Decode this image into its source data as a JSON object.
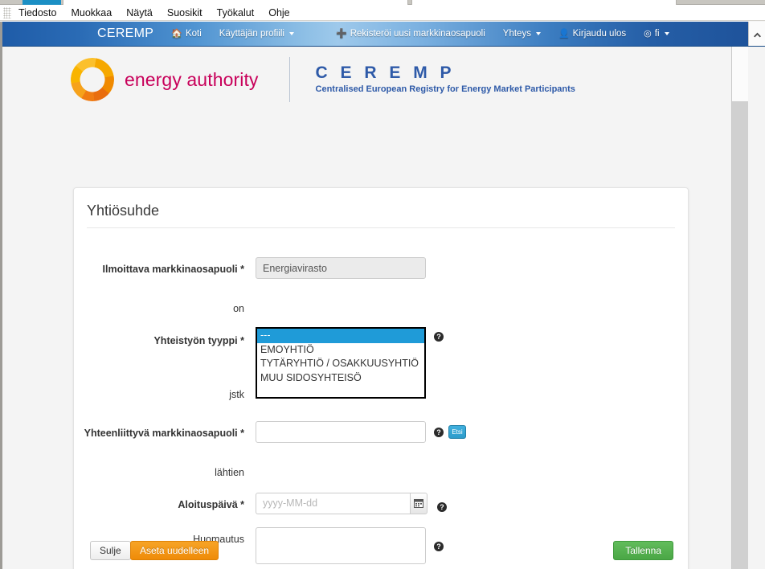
{
  "browser": {
    "menu_items": [
      "Tiedosto",
      "Muokkaa",
      "Näytä",
      "Suosikit",
      "Työkalut",
      "Ohje"
    ]
  },
  "topnav": {
    "brand": "CEREMP",
    "links": [
      {
        "label": "Koti",
        "icon": "home-icon",
        "glyph": "⌂",
        "caret": false
      },
      {
        "label": "Käyttäjän profiili",
        "icon": "",
        "glyph": "",
        "caret": true
      },
      {
        "label": "Rekisteröi uusi markkinaosapuoli",
        "icon": "plus-icon",
        "glyph": "✚",
        "caret": false
      },
      {
        "label": "Yhteys",
        "icon": "",
        "glyph": "",
        "caret": true
      },
      {
        "label": "Kirjaudu ulos",
        "icon": "user-icon",
        "glyph": "👤",
        "caret": false
      },
      {
        "label": "fi",
        "icon": "globe-icon",
        "glyph": "◉",
        "caret": true
      }
    ],
    "scroll_up_glyph": "▲"
  },
  "header": {
    "energy_authority": "energy authority",
    "ceremp_title": "C E R E M P",
    "ceremp_subtitle": "Centralised European Registry for Energy Market Participants"
  },
  "card": {
    "title": "Yhtiösuhde",
    "fields": {
      "reporting_party": {
        "label": "Ilmoittava markkinaosapuoli *",
        "value": "Energiavirasto"
      },
      "on_label": "on",
      "cooperation_type": {
        "label": "Yhteistyön tyyppi *",
        "options": [
          "---",
          "EMOYHTIÖ",
          "TYTÄRYHTIÖ / OSAKKUUSYHTIÖ",
          "MUU SIDOSYHTEISÖ"
        ],
        "selected_index": 0,
        "help": "?"
      },
      "jstk_label": "jstk",
      "related_party": {
        "label": "Yhteenliittyvä markkinaosapuoli *",
        "value": "",
        "help": "?",
        "search_button_label": "Etsi"
      },
      "from_label": "lähtien",
      "start_date": {
        "label": "Aloituspäivä *",
        "value": "",
        "placeholder": "yyyy-MM-dd",
        "calendar_icon": "calendar-icon",
        "help": "?"
      },
      "note": {
        "label": "Huomautus",
        "value": "",
        "help": "?"
      }
    },
    "buttons": {
      "close": "Sulje",
      "reset": "Aseta uudelleen",
      "save": "Tallenna"
    }
  },
  "colors": {
    "nav_blue_dark": "#1f5ca8",
    "nav_blue_light": "#9ec9eb",
    "brand_magenta": "#c8005a",
    "ceremp_blue": "#2e5aa8",
    "select_highlight": "#1f9bd8",
    "save_green": "#4aa746",
    "reset_orange": "#ef8b08"
  }
}
